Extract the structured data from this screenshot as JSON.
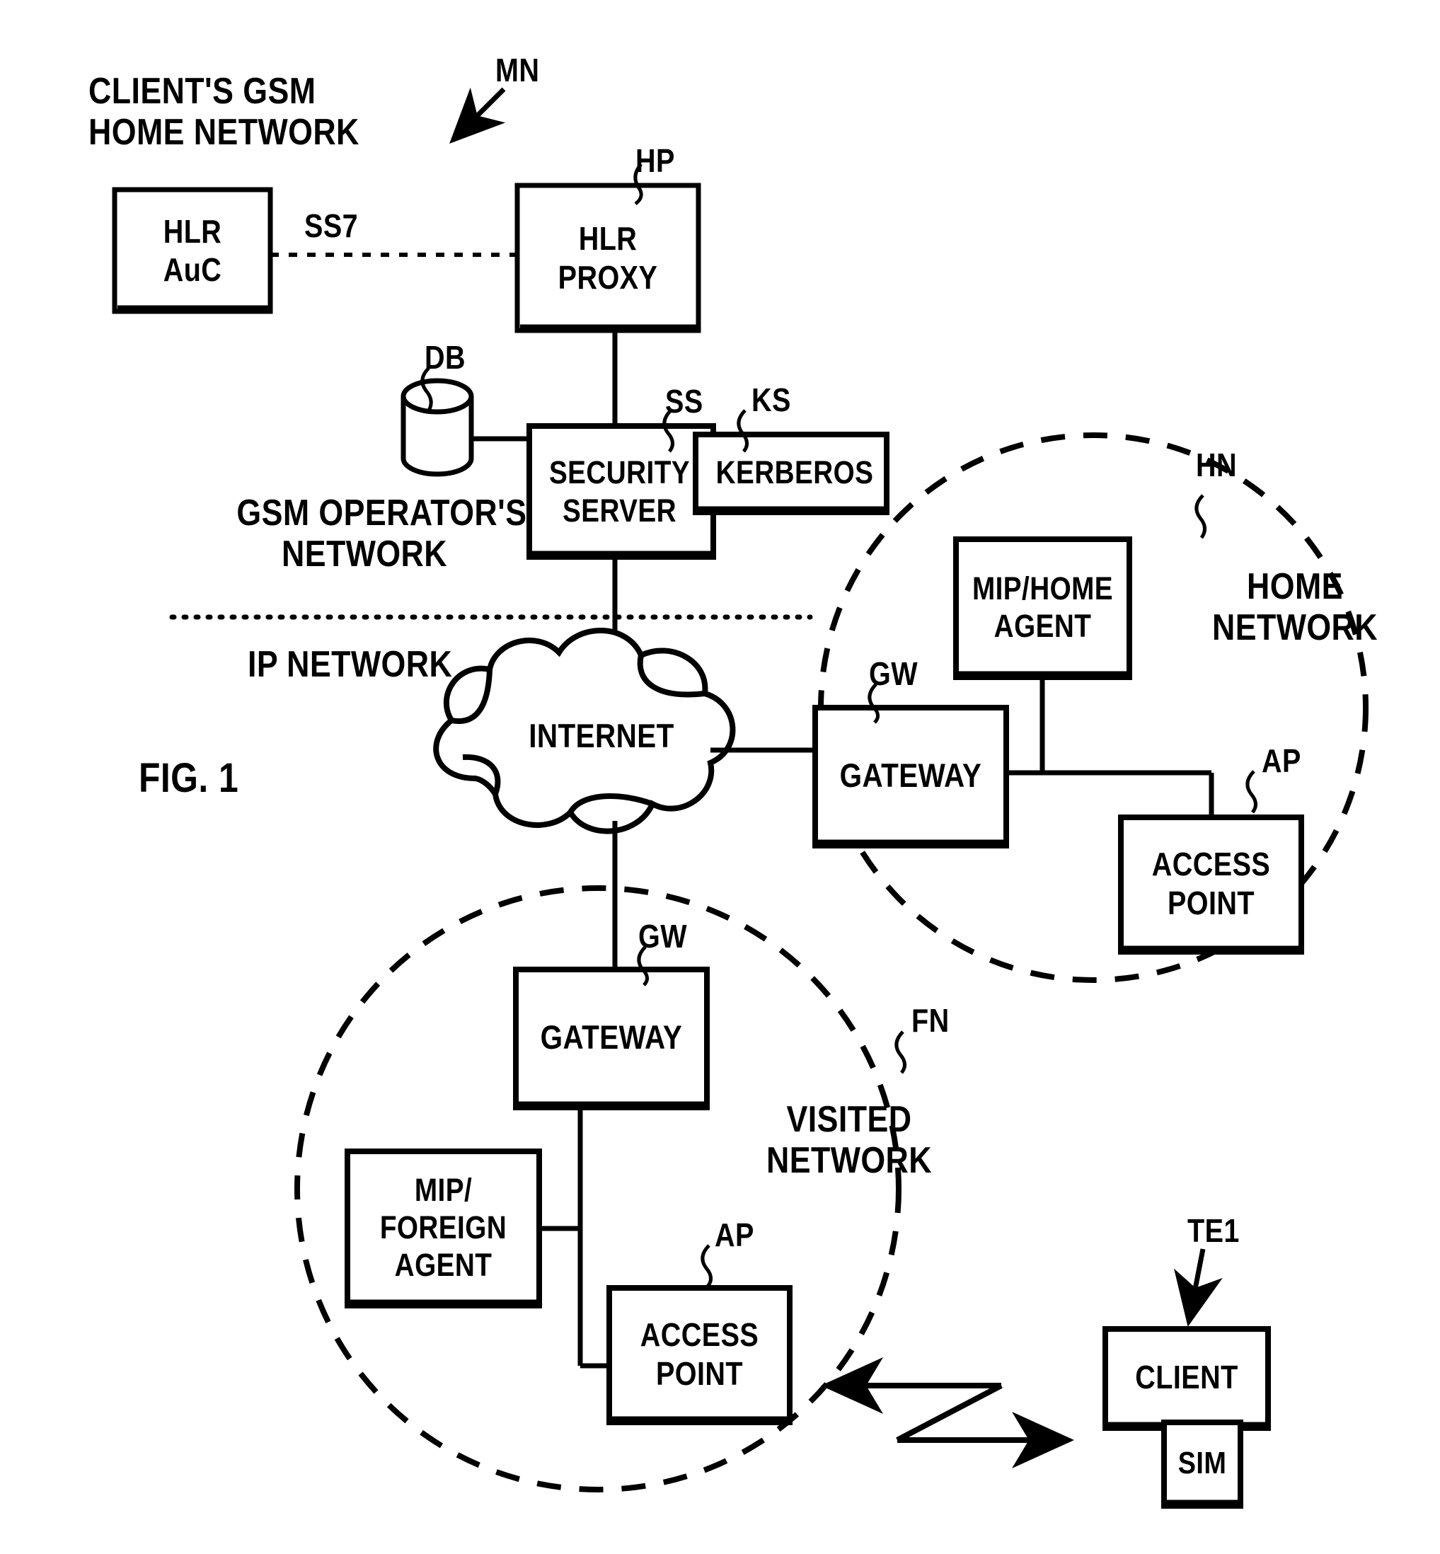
{
  "figure": {
    "label": "FIG. 1",
    "title": "GSM / Mobile IP security architecture block diagram"
  },
  "regions": {
    "gsm_home_network": "CLIENT'S GSM\nHOME NETWORK",
    "gsm_operator_network": "GSM OPERATOR'S\nNETWORK",
    "ip_network": "IP NETWORK",
    "home_network": "HOME\nNETWORK",
    "visited_network": "VISITED\nNETWORK"
  },
  "nodes": {
    "hlr_auc": {
      "label": "HLR\nAuC",
      "ref": ""
    },
    "hlr_proxy": {
      "label": "HLR\nPROXY",
      "ref": "HP"
    },
    "database": {
      "label": "",
      "ref": "DB"
    },
    "security_server": {
      "label": "SECURITY\nSERVER",
      "ref": "SS"
    },
    "kerberos": {
      "label": "KERBEROS",
      "ref": "KS"
    },
    "internet": {
      "label": "INTERNET",
      "ref": ""
    },
    "mip_home_agent": {
      "label": "MIP/HOME\nAGENT",
      "ref": ""
    },
    "home_gateway": {
      "label": "GATEWAY",
      "ref": "GW"
    },
    "home_access_point": {
      "label": "ACCESS\nPOINT",
      "ref": "AP"
    },
    "visited_gateway": {
      "label": "GATEWAY",
      "ref": "GW"
    },
    "mip_foreign_agent": {
      "label": "MIP/\nFOREIGN\nAGENT",
      "ref": ""
    },
    "visited_access_point": {
      "label": "ACCESS\nPOINT",
      "ref": "AP"
    },
    "client": {
      "label": "CLIENT",
      "ref": "TE1"
    },
    "sim": {
      "label": "SIM",
      "ref": ""
    }
  },
  "connections": {
    "ss7": "SS7"
  },
  "callouts": {
    "mn": "MN",
    "hn": "HN",
    "fn": "FN"
  },
  "colors": {
    "ink": "#000000",
    "background": "#ffffff"
  }
}
